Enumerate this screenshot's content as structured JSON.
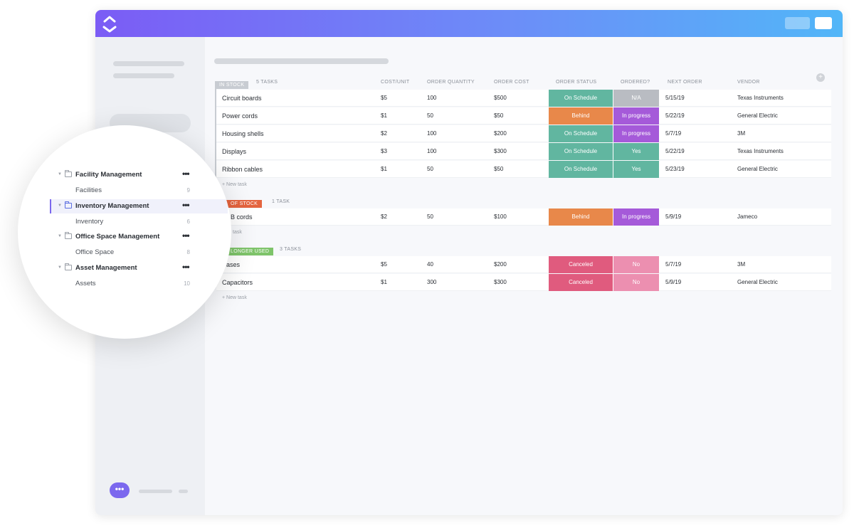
{
  "columns": {
    "task_count_label": "5 TASKS",
    "cost_unit": "COST/UNIT",
    "order_quantity": "ORDER QUANTITY",
    "order_cost": "ORDER COST",
    "order_status": "ORDER STATUS",
    "ordered": "ORDERED?",
    "next_order": "NEXT ORDER",
    "vendor": "VENDOR"
  },
  "add_column_icon": "+",
  "chat_icon": "•••",
  "new_task_label": "+ New task",
  "colors": {
    "accent": "#7b68ee",
    "on_schedule": "#61b6a0",
    "behind": "#e8884a",
    "canceled": "#e05b7e",
    "in_progress": "#a55ad9",
    "yes": "#61b6a0",
    "na": "#b9bcc2",
    "no": "#ec8fb0",
    "in_stock": "#c8ccd2",
    "out_of_stock": "#e4643f",
    "no_longer_used": "#7ec46a"
  },
  "groups": [
    {
      "badge": "IN STOCK",
      "count": "5 TASKS",
      "rows": [
        {
          "name": "Circuit boards",
          "cost": "$5",
          "qty": "100",
          "order_cost": "$500",
          "status": "On Schedule",
          "ordered": "N/A",
          "next": "5/15/19",
          "vendor": "Texas Instruments"
        },
        {
          "name": "Power cords",
          "cost": "$1",
          "qty": "50",
          "order_cost": "$50",
          "status": "Behind",
          "ordered": "In progress",
          "next": "5/22/19",
          "vendor": "General Electric"
        },
        {
          "name": "Housing shells",
          "cost": "$2",
          "qty": "100",
          "order_cost": "$200",
          "status": "On Schedule",
          "ordered": "In progress",
          "next": "5/7/19",
          "vendor": "3M"
        },
        {
          "name": "Displays",
          "cost": "$3",
          "qty": "100",
          "order_cost": "$300",
          "status": "On Schedule",
          "ordered": "Yes",
          "next": "5/22/19",
          "vendor": "Texas Instruments"
        },
        {
          "name": "Ribbon cables",
          "cost": "$1",
          "qty": "50",
          "order_cost": "$50",
          "status": "On Schedule",
          "ordered": "Yes",
          "next": "5/23/19",
          "vendor": "General Electric"
        }
      ]
    },
    {
      "badge": "OF STOCK",
      "count": "1 TASK",
      "rows": [
        {
          "name": "B cords",
          "cost": "$2",
          "qty": "50",
          "order_cost": "$100",
          "status": "Behind",
          "ordered": "In progress",
          "next": "5/9/19",
          "vendor": "Jameco"
        }
      ]
    },
    {
      "badge": "LONGER USED",
      "count": "3 TASKS",
      "rows": [
        {
          "name": "ases",
          "cost": "$5",
          "qty": "40",
          "order_cost": "$200",
          "status": "Canceled",
          "ordered": "No",
          "next": "5/7/19",
          "vendor": "3M"
        },
        {
          "name": "Capacitors",
          "cost": "$1",
          "qty": "300",
          "order_cost": "$300",
          "status": "Canceled",
          "ordered": "No",
          "next": "5/9/19",
          "vendor": "General Electric"
        }
      ]
    }
  ],
  "new_task_partial": "w task",
  "nav": {
    "items": [
      {
        "label": "Facility Management",
        "sub": "Facilities",
        "count": "9"
      },
      {
        "label": "Inventory Management",
        "sub": "Inventory",
        "count": "6"
      },
      {
        "label": "Office Space Management",
        "sub": "Office Space",
        "count": "8"
      },
      {
        "label": "Asset Management",
        "sub": "Assets",
        "count": "10"
      }
    ],
    "more_icon": "•••",
    "caret_icon": "▼"
  }
}
